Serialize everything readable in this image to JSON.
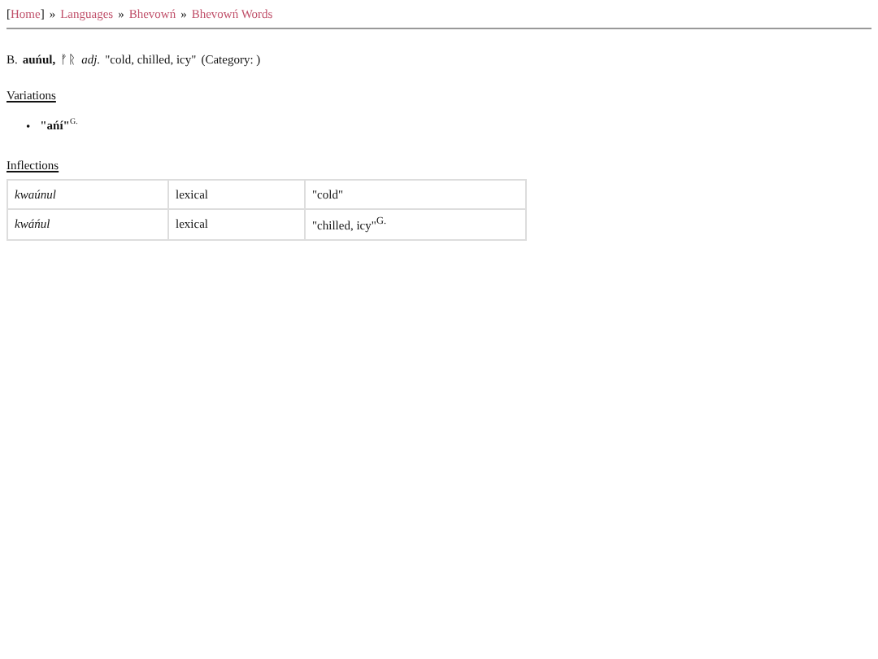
{
  "breadcrumb": {
    "open": "[",
    "close": "]",
    "links": [
      "Home",
      "Languages",
      "Bhevowń",
      "Bhevowń Words"
    ]
  },
  "separator": "»",
  "entry": {
    "prefix": "B.",
    "word": "auńul,",
    "native": "ᚠᚱ",
    "pos": "adj.",
    "gloss": "\"cold, chilled, icy\"",
    "category": "(Category: )"
  },
  "variations": {
    "heading": "Variations",
    "marker": "•",
    "items": [
      {
        "text": "\"ańí\"",
        "note": "G."
      }
    ]
  },
  "inflections": {
    "heading": "Inflections",
    "rows": [
      {
        "form": "kwaúnul",
        "type": "lexical",
        "gloss": "\"cold\""
      },
      {
        "form": "kwáńul",
        "type": "lexical",
        "gloss": "\"chilled, icy\"$^{G.}$"
      }
    ]
  }
}
